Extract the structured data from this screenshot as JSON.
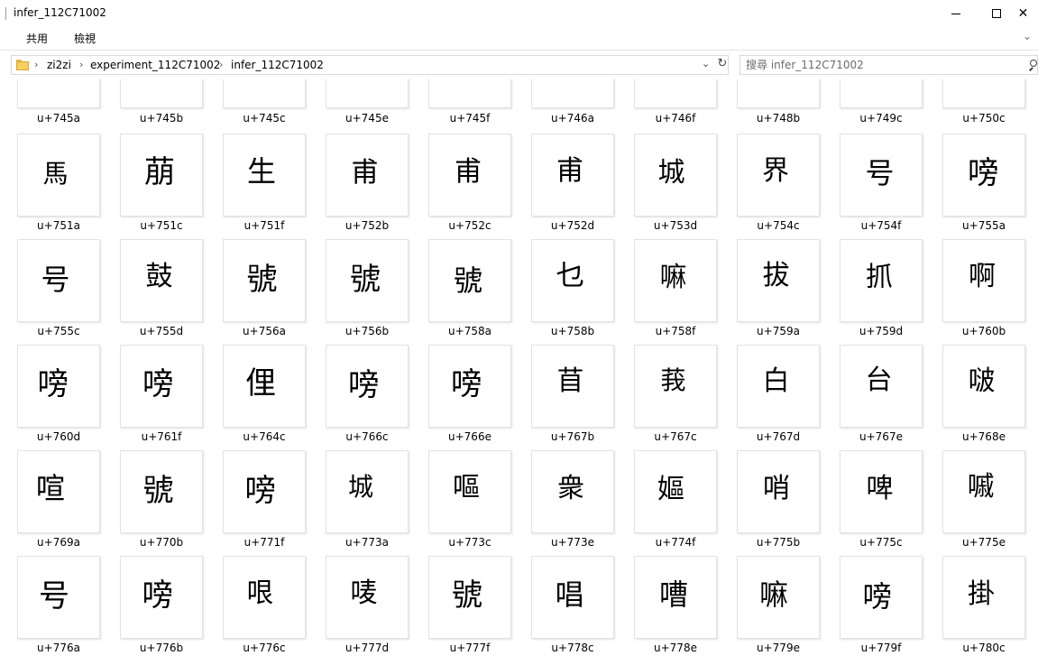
{
  "window": {
    "title": "infer_112C71002"
  },
  "ribbon": {
    "tabs": [
      "共用",
      "檢視"
    ],
    "expand_icon": "chevron-down-icon"
  },
  "address_bar": {
    "breadcrumbs": [
      "zi2zi",
      "experiment_112C71002",
      "infer_112C71002"
    ],
    "separator": "›",
    "dropdown_icon": "chevron-down-icon",
    "refresh_icon": "refresh-icon"
  },
  "search": {
    "placeholder": "搜尋 infer_112C71002"
  },
  "files": {
    "top_row_labels": [
      "u+745a",
      "u+745b",
      "u+745c",
      "u+745e",
      "u+745f",
      "u+746a",
      "u+746f",
      "u+748b",
      "u+749c",
      "u+750c"
    ],
    "items": [
      {
        "label": "u+751a",
        "glyph": "馬"
      },
      {
        "label": "u+751c",
        "glyph": "萠"
      },
      {
        "label": "u+751f",
        "glyph": "生"
      },
      {
        "label": "u+752b",
        "glyph": "甫"
      },
      {
        "label": "u+752c",
        "glyph": "甫"
      },
      {
        "label": "u+752d",
        "glyph": "甫"
      },
      {
        "label": "u+753d",
        "glyph": "城"
      },
      {
        "label": "u+754c",
        "glyph": "界"
      },
      {
        "label": "u+754f",
        "glyph": "号"
      },
      {
        "label": "u+755a",
        "glyph": "嗙"
      },
      {
        "label": "u+755c",
        "glyph": "号"
      },
      {
        "label": "u+755d",
        "glyph": "鼓"
      },
      {
        "label": "u+756a",
        "glyph": "號"
      },
      {
        "label": "u+756b",
        "glyph": "號"
      },
      {
        "label": "u+758a",
        "glyph": "號"
      },
      {
        "label": "u+758b",
        "glyph": "乜"
      },
      {
        "label": "u+758f",
        "glyph": "嘛"
      },
      {
        "label": "u+759a",
        "glyph": "拔"
      },
      {
        "label": "u+759d",
        "glyph": "抓"
      },
      {
        "label": "u+760b",
        "glyph": "啊"
      },
      {
        "label": "u+760d",
        "glyph": "嗙"
      },
      {
        "label": "u+761f",
        "glyph": "嗙"
      },
      {
        "label": "u+764c",
        "glyph": "俚"
      },
      {
        "label": "u+766c",
        "glyph": "嗙"
      },
      {
        "label": "u+766e",
        "glyph": "嗙"
      },
      {
        "label": "u+767b",
        "glyph": "苜"
      },
      {
        "label": "u+767c",
        "glyph": "莪"
      },
      {
        "label": "u+767d",
        "glyph": "白"
      },
      {
        "label": "u+767e",
        "glyph": "台"
      },
      {
        "label": "u+768e",
        "glyph": "啵"
      },
      {
        "label": "u+769a",
        "glyph": "喧"
      },
      {
        "label": "u+770b",
        "glyph": "號"
      },
      {
        "label": "u+771f",
        "glyph": "嗙"
      },
      {
        "label": "u+773a",
        "glyph": "城"
      },
      {
        "label": "u+773c",
        "glyph": "嘔"
      },
      {
        "label": "u+773e",
        "glyph": "衆"
      },
      {
        "label": "u+774f",
        "glyph": "嫗"
      },
      {
        "label": "u+775b",
        "glyph": "哨"
      },
      {
        "label": "u+775c",
        "glyph": "啤"
      },
      {
        "label": "u+775e",
        "glyph": "嘁"
      },
      {
        "label": "u+776a",
        "glyph": "号"
      },
      {
        "label": "u+776b",
        "glyph": "嗙"
      },
      {
        "label": "u+776c",
        "glyph": "哏"
      },
      {
        "label": "u+777d",
        "glyph": "唛"
      },
      {
        "label": "u+777f",
        "glyph": "號"
      },
      {
        "label": "u+778c",
        "glyph": "唱"
      },
      {
        "label": "u+778e",
        "glyph": "嘈"
      },
      {
        "label": "u+779e",
        "glyph": "嘛"
      },
      {
        "label": "u+779f",
        "glyph": "嗙"
      },
      {
        "label": "u+780c",
        "glyph": "掛"
      }
    ]
  }
}
